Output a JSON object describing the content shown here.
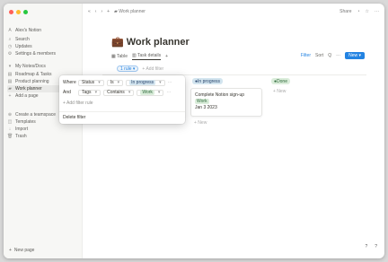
{
  "window": {
    "traffic_colors": [
      "#ff5f57",
      "#febc2e",
      "#28c840"
    ]
  },
  "sidebar": {
    "workspace": "Alex's Notion",
    "items": [
      {
        "icon": "search-icon",
        "label": "Search"
      },
      {
        "icon": "clock-icon",
        "label": "Updates"
      },
      {
        "icon": "gear-icon",
        "label": "Settings & members"
      }
    ],
    "section_label": "My Notes/Docs",
    "pages": [
      {
        "icon": "page-icon",
        "label": "Roadmap & Tasks"
      },
      {
        "icon": "page-icon",
        "label": "Product planning"
      },
      {
        "icon": "briefcase-icon",
        "label": "Work planner"
      },
      {
        "icon": "plus-icon",
        "label": "Add a page"
      }
    ],
    "footer_items": [
      {
        "icon": "create-icon",
        "label": "Create a teamspace"
      },
      {
        "icon": "template-icon",
        "label": "Templates"
      },
      {
        "icon": "import-icon",
        "label": "Import"
      },
      {
        "icon": "trash-icon",
        "label": "Trash"
      }
    ],
    "new_page": "New page"
  },
  "topbar": {
    "breadcrumb": "Work planner",
    "share": "Share",
    "icons": [
      "comment-icon",
      "star-icon",
      "more-icon"
    ]
  },
  "page": {
    "emoji": "💼",
    "title": "Work planner",
    "views": [
      {
        "label": "Table",
        "active": false
      },
      {
        "label": "Task details",
        "active": true
      }
    ],
    "add_view": "+",
    "toolbar": {
      "filter": "Filter",
      "sort": "Sort",
      "search": "Q",
      "new": "New"
    }
  },
  "filters": {
    "active_chip": "1 rule",
    "add_filter": "+ Add filter"
  },
  "board": {
    "columns": [
      {
        "label": "In progress",
        "color": "#d3e5ef",
        "text": "#28456c"
      },
      {
        "label": "Done",
        "color": "#dbeddb",
        "text": "#2f6b3c"
      }
    ],
    "card": {
      "title": "Complete Notion sign-up",
      "tag": "Work",
      "date": "Jan 3 2023"
    },
    "new_label": "+ New",
    "new_label_2": "+ New"
  },
  "filter_popover": {
    "row1": {
      "prefix": "Where",
      "field": "Status",
      "op": "Is",
      "value": "In progress"
    },
    "row2": {
      "prefix": "And",
      "field": "Tags",
      "op": "Contains",
      "value": "Work"
    },
    "add_rule": "+ Add filter rule",
    "delete": "Delete filter"
  },
  "help": {
    "items": [
      "?",
      "?"
    ]
  }
}
